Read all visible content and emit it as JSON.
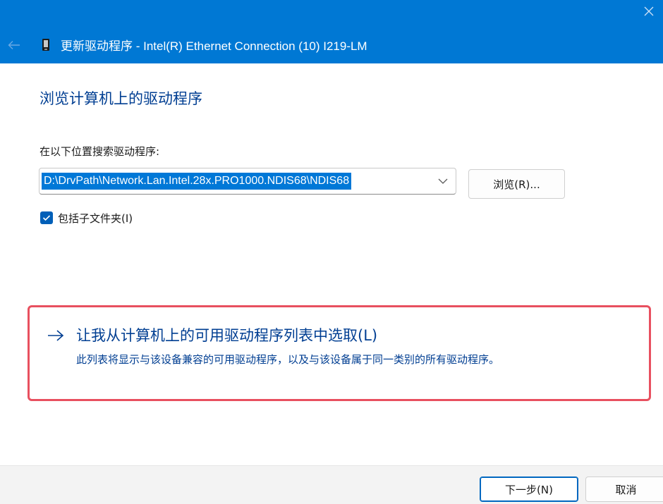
{
  "header": {
    "title": "更新驱动程序 - Intel(R) Ethernet Connection (10) I219-LM"
  },
  "main": {
    "heading": "浏览计算机上的驱动程序",
    "search_label": "在以下位置搜索驱动程序:",
    "path_value": "D:\\DrvPath\\Network.Lan.Intel.28x.PRO1000.NDIS68\\NDIS68",
    "browse_label": "浏览(R)...",
    "include_subfolders": {
      "label": "包括子文件夹(I)",
      "checked": true
    },
    "pick_option": {
      "title": "让我从计算机上的可用驱动程序列表中选取(L)",
      "description": "此列表将显示与该设备兼容的可用驱动程序，以及与该设备属于同一类别的所有驱动程序。"
    }
  },
  "footer": {
    "next_label": "下一步(N)",
    "cancel_label": "取消"
  },
  "colors": {
    "titlebar": "#0078d4",
    "link_text": "#003e92",
    "highlight_border": "#e8505f",
    "selection": "#0078d7",
    "checkbox": "#005fb8"
  },
  "icons": {
    "close": "close-icon",
    "back": "back-arrow-icon",
    "device": "network-adapter-icon",
    "dropdown": "chevron-down-icon",
    "check": "checkmark-icon",
    "option_arrow": "arrow-right-icon"
  }
}
